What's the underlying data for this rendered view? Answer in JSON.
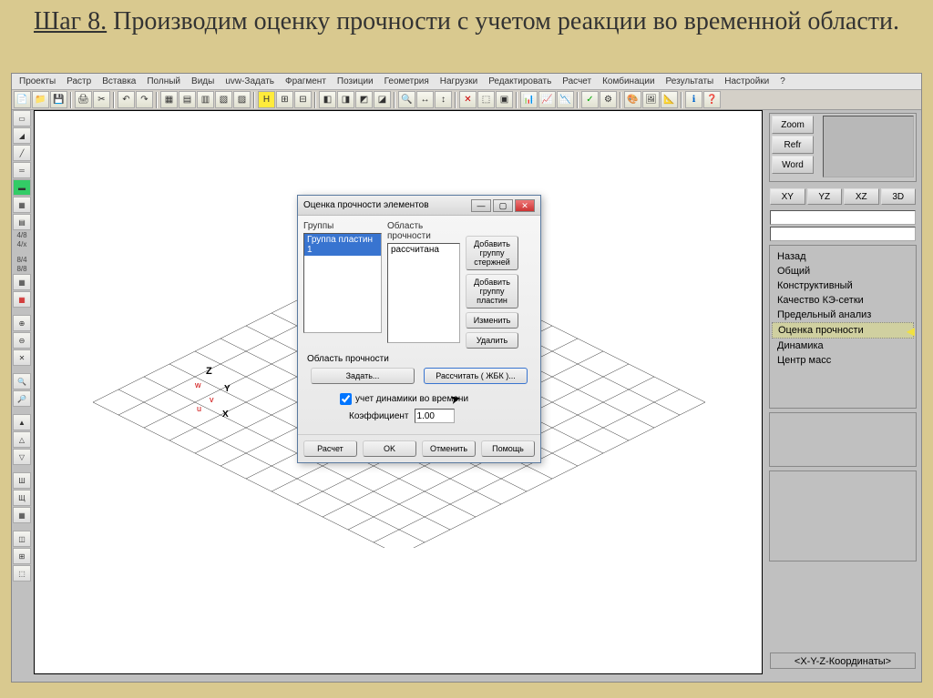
{
  "title": {
    "step": "Шаг 8.",
    "rest": " Производим оценку прочности с учетом реакции во временной области."
  },
  "menu": [
    "Проекты",
    "Растр",
    "Вставка",
    "Полный",
    "Виды",
    "uvw-Задать",
    "Фрагмент",
    "Позиции",
    "Геометрия",
    "Нагрузки",
    "Редактировать",
    "Расчет",
    "Комбинации",
    "Результаты",
    "Настройки",
    "?"
  ],
  "left_labels": [
    "4/8",
    "4/x",
    "8/4",
    "8/8"
  ],
  "right_panel": {
    "zoom": "Zoom",
    "refr": "Refr",
    "word": "Word",
    "views": [
      "XY",
      "YZ",
      "XZ",
      "3D"
    ],
    "menu_items": [
      "Назад",
      "Общий",
      "Конструктивный",
      "Качество КЭ-сетки",
      "Предельный анализ",
      "Оценка прочности",
      "Динамика",
      "Центр масс"
    ],
    "active_index": 5,
    "coord": "<X-Y-Z-Координаты>"
  },
  "axes": {
    "z": "Z",
    "y": "Y",
    "x": "X",
    "w": "w",
    "v": "v",
    "u": "u"
  },
  "dialog": {
    "title": "Оценка прочности элементов",
    "groups_label": "Группы",
    "region_label": "Область прочности",
    "group_item": "Группа пластин 1",
    "region_item": "рассчитана",
    "btn_add_rods": "Добавить группу стержней",
    "btn_add_plates": "Добавить группу пластин",
    "btn_edit": "Изменить",
    "btn_delete": "Удалить",
    "section_label": "Область прочности",
    "btn_set": "Задать...",
    "btn_calc": "Рассчитать ( ЖБК )...",
    "check_label": "учет динамики во времени",
    "coef_label": "Коэффициент",
    "coef_value": "1.00",
    "btn_run": "Расчет",
    "btn_ok": "OK",
    "btn_cancel": "Отменить",
    "btn_help": "Помощь"
  }
}
